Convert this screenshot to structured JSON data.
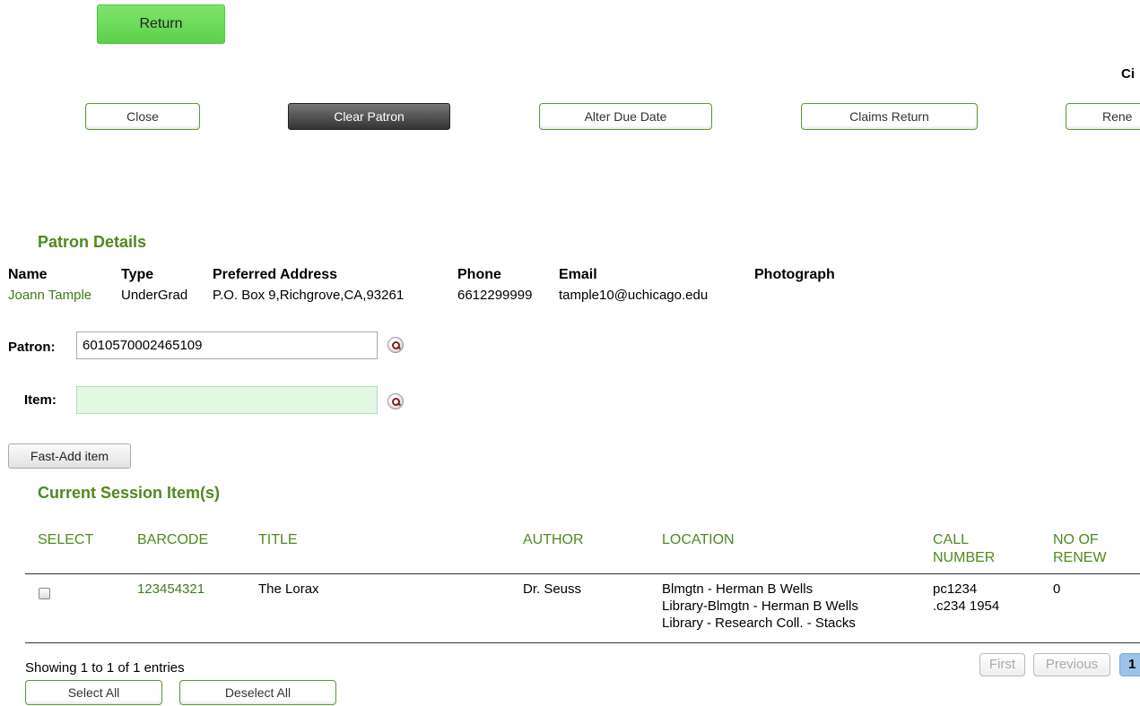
{
  "header": {
    "return_label": "Return",
    "circ_label": "Ci"
  },
  "toolbar": {
    "close_label": "Close",
    "clear_patron_label": "Clear Patron",
    "alter_due_date_label": "Alter Due Date",
    "claims_return_label": "Claims Return",
    "renew_label": "Rene"
  },
  "patron_details": {
    "title": "Patron Details",
    "headers": {
      "name": "Name",
      "type": "Type",
      "address": "Preferred Address",
      "phone": "Phone",
      "email": "Email",
      "photo": "Photograph"
    },
    "values": {
      "name": "Joann Tample",
      "type": "UnderGrad",
      "address": "P.O. Box 9,Richgrove,CA,93261",
      "phone": "6612299999",
      "email": "tample10@uchicago.edu"
    }
  },
  "form": {
    "patron_label": "Patron:",
    "patron_value": "6010570002465109",
    "item_label": "Item:",
    "item_value": "",
    "fast_add_label": "Fast-Add item"
  },
  "session": {
    "title": "Current Session Item(s)",
    "columns": {
      "select": "SELECT",
      "barcode": "BARCODE",
      "title": "TITLE",
      "author": "AUTHOR",
      "location": "LOCATION",
      "call_number_1": "CALL",
      "call_number_2": "NUMBER",
      "renew_1": "NO OF",
      "renew_2": "RENEW"
    },
    "rows": [
      {
        "barcode": "123454321",
        "title": "The Lorax",
        "author": "Dr. Seuss",
        "location_1": "Blmgtn - Herman B Wells",
        "location_2": "Library-Blmgtn - Herman B Wells",
        "location_3": "Library - Research Coll. - Stacks",
        "call_1": "pc1234",
        "call_2": ".c234 1954",
        "renew": "0",
        "selected": false
      }
    ],
    "info": "Showing 1 to 1 of 1 entries",
    "select_all_label": "Select All",
    "deselect_all_label": "Deselect All",
    "pagination": {
      "first": "First",
      "previous": "Previous",
      "current_page": "1"
    }
  },
  "colors": {
    "accent_green": "#4e8a1f",
    "return_button": "#5cd14a",
    "active_page": "#9ec3ea"
  }
}
